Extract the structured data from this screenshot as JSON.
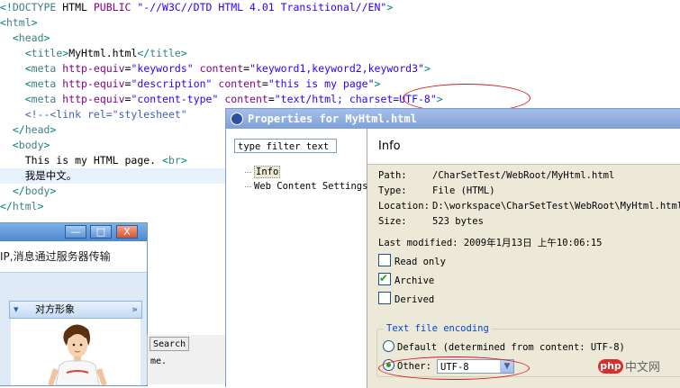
{
  "editor": {
    "lines": [
      {
        "parts": [
          {
            "c": "br",
            "t": "<!"
          },
          {
            "c": "tg",
            "t": "DOCTYPE"
          },
          {
            "c": "tx",
            "t": " HTML "
          },
          {
            "c": "at",
            "t": "PUBLIC"
          },
          {
            "c": "tx",
            "t": " "
          },
          {
            "c": "st",
            "t": "\"-//W3C//DTD HTML 4.01 Transitional//EN\""
          },
          {
            "c": "br",
            "t": ">"
          }
        ]
      },
      {
        "parts": [
          {
            "c": "br",
            "t": "<"
          },
          {
            "c": "tg",
            "t": "html"
          },
          {
            "c": "br",
            "t": ">"
          }
        ]
      },
      {
        "parts": [
          {
            "c": "tx",
            "t": "  "
          },
          {
            "c": "br",
            "t": "<"
          },
          {
            "c": "tg",
            "t": "head"
          },
          {
            "c": "br",
            "t": ">"
          }
        ]
      },
      {
        "parts": [
          {
            "c": "tx",
            "t": "    "
          },
          {
            "c": "br",
            "t": "<"
          },
          {
            "c": "tg",
            "t": "title"
          },
          {
            "c": "br",
            "t": ">"
          },
          {
            "c": "tx",
            "t": "MyHtml.html"
          },
          {
            "c": "br",
            "t": "</"
          },
          {
            "c": "tg",
            "t": "title"
          },
          {
            "c": "br",
            "t": ">"
          }
        ]
      },
      {
        "parts": [
          {
            "c": "tx",
            "t": "    "
          },
          {
            "c": "br",
            "t": "<"
          },
          {
            "c": "tg",
            "t": "meta"
          },
          {
            "c": "tx",
            "t": " "
          },
          {
            "c": "at",
            "t": "http-equiv"
          },
          {
            "c": "tx",
            "t": "="
          },
          {
            "c": "st",
            "t": "\"keywords\""
          },
          {
            "c": "tx",
            "t": " "
          },
          {
            "c": "at",
            "t": "content"
          },
          {
            "c": "tx",
            "t": "="
          },
          {
            "c": "st",
            "t": "\"keyword1,keyword2,keyword3\""
          },
          {
            "c": "br",
            "t": ">"
          }
        ]
      },
      {
        "parts": [
          {
            "c": "tx",
            "t": "    "
          },
          {
            "c": "br",
            "t": "<"
          },
          {
            "c": "tg",
            "t": "meta"
          },
          {
            "c": "tx",
            "t": " "
          },
          {
            "c": "at",
            "t": "http-equiv"
          },
          {
            "c": "tx",
            "t": "="
          },
          {
            "c": "st",
            "t": "\"description\""
          },
          {
            "c": "tx",
            "t": " "
          },
          {
            "c": "at",
            "t": "content"
          },
          {
            "c": "tx",
            "t": "="
          },
          {
            "c": "st",
            "t": "\"this is my page\""
          },
          {
            "c": "br",
            "t": ">"
          }
        ]
      },
      {
        "parts": [
          {
            "c": "tx",
            "t": "    "
          },
          {
            "c": "br",
            "t": "<"
          },
          {
            "c": "tg",
            "t": "meta"
          },
          {
            "c": "tx",
            "t": " "
          },
          {
            "c": "at",
            "t": "http-equiv"
          },
          {
            "c": "tx",
            "t": "="
          },
          {
            "c": "st",
            "t": "\"content-type\""
          },
          {
            "c": "tx",
            "t": " "
          },
          {
            "c": "at",
            "t": "content"
          },
          {
            "c": "tx",
            "t": "="
          },
          {
            "c": "st",
            "t": "\"text/html; charset=UTF-8\""
          },
          {
            "c": "br",
            "t": ">"
          }
        ]
      },
      {
        "parts": [
          {
            "c": "tx",
            "t": "    "
          },
          {
            "c": "cm",
            "t": "<!--<link rel=\"stylesheet\""
          }
        ]
      },
      {
        "parts": [
          {
            "c": "tx",
            "t": "  "
          },
          {
            "c": "br",
            "t": "</"
          },
          {
            "c": "tg",
            "t": "head"
          },
          {
            "c": "br",
            "t": ">"
          }
        ]
      },
      {
        "parts": [
          {
            "c": "tx",
            "t": "  "
          },
          {
            "c": "br",
            "t": "<"
          },
          {
            "c": "tg",
            "t": "body"
          },
          {
            "c": "br",
            "t": ">"
          }
        ]
      },
      {
        "parts": [
          {
            "c": "tx",
            "t": "    This is my HTML page. "
          },
          {
            "c": "br",
            "t": "<"
          },
          {
            "c": "tg",
            "t": "br"
          },
          {
            "c": "br",
            "t": ">"
          }
        ]
      },
      {
        "parts": [
          {
            "c": "tx",
            "t": "    我是中文。"
          }
        ],
        "highlight": true
      },
      {
        "parts": [
          {
            "c": "tx",
            "t": "  "
          },
          {
            "c": "br",
            "t": "</"
          },
          {
            "c": "tg",
            "t": "body"
          },
          {
            "c": "br",
            "t": ">"
          }
        ]
      },
      {
        "parts": [
          {
            "c": "br",
            "t": "</"
          },
          {
            "c": "tg",
            "t": "html"
          },
          {
            "c": "br",
            "t": ">"
          }
        ]
      }
    ]
  },
  "chat": {
    "min_glyph": "—",
    "max_glyph": "□",
    "close_glyph": "X",
    "message": "IP,消息通过服务器传输",
    "peer_header": "对方形象",
    "peer_toggle": "▾",
    "peer_expand": "»"
  },
  "search_panel": {
    "tab_label": "Search",
    "text": "me."
  },
  "dialog": {
    "title": "Properties for MyHtml.html",
    "filter_placeholder": "type filter text",
    "tree": [
      "Info",
      "Web Content Settings"
    ],
    "section_title": "Info",
    "props": [
      {
        "key": "Path:",
        "value": "/CharSetTest/WebRoot/MyHtml.html"
      },
      {
        "key": "Type:",
        "value": "File  (HTML)"
      },
      {
        "key": "Location:",
        "value": "D:\\workspace\\CharSetTest\\WebRoot\\MyHtml.html"
      },
      {
        "key": "Size:",
        "value": "523  bytes"
      }
    ],
    "last_modified_label": "Last modified:",
    "last_modified_value": "2009年1月13日 上午10:06:15",
    "checkboxes": [
      {
        "label": "Read only",
        "checked": false
      },
      {
        "label": "Archive",
        "checked": true
      },
      {
        "label": "Derived",
        "checked": false
      }
    ],
    "encoding_group": "Text file encoding",
    "radio_default": "Default (determined from content: UTF-8)",
    "radio_other": "Other:",
    "other_value": "UTF-8"
  },
  "watermark": {
    "badge": "php",
    "text": "中文网"
  },
  "colors": {
    "annotation_red": "#d81818",
    "tag": "#3f7f7f",
    "attribute": "#7f007f",
    "string": "#2a00ff",
    "comment": "#3f5fbf"
  }
}
